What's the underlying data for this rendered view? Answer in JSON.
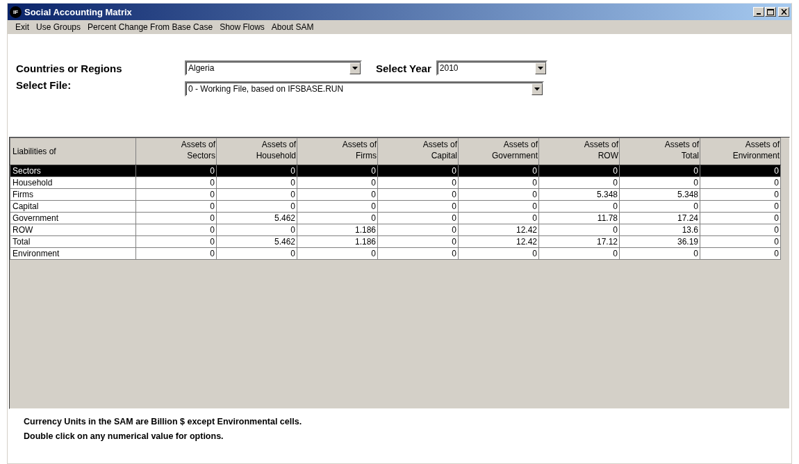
{
  "window": {
    "title": "Social Accounting Matrix",
    "app_icon_text": "IF"
  },
  "menu": [
    {
      "label": "Exit"
    },
    {
      "label": "Use Groups"
    },
    {
      "label": "Percent Change From Base Case"
    },
    {
      "label": "Show Flows"
    },
    {
      "label": "About SAM"
    }
  ],
  "selectors": {
    "region": {
      "label": "Countries or Regions",
      "value": "Algeria"
    },
    "year": {
      "label": "Select Year",
      "value": "2010"
    },
    "file": {
      "label": "Select File:",
      "value": "0 - Working File, based on IFSBASE.RUN"
    }
  },
  "table": {
    "corner": "Liabilities of",
    "columns": [
      "Assets of Sectors",
      "Assets of Household",
      "Assets of Firms",
      "Assets of Capital",
      "Assets of Government",
      "Assets of ROW",
      "Assets of Total",
      "Assets of Environment"
    ],
    "rows": [
      {
        "label": "Sectors",
        "selected": true,
        "cells": [
          "0",
          "0",
          "0",
          "0",
          "0",
          "0",
          "0",
          "0"
        ]
      },
      {
        "label": "Household",
        "selected": false,
        "cells": [
          "0",
          "0",
          "0",
          "0",
          "0",
          "0",
          "0",
          "0"
        ]
      },
      {
        "label": "Firms",
        "selected": false,
        "cells": [
          "0",
          "0",
          "0",
          "0",
          "0",
          "5.348",
          "5.348",
          "0"
        ]
      },
      {
        "label": "Capital",
        "selected": false,
        "cells": [
          "0",
          "0",
          "0",
          "0",
          "0",
          "0",
          "0",
          "0"
        ]
      },
      {
        "label": "Government",
        "selected": false,
        "cells": [
          "0",
          "5.462",
          "0",
          "0",
          "0",
          "11.78",
          "17.24",
          "0"
        ]
      },
      {
        "label": "ROW",
        "selected": false,
        "cells": [
          "0",
          "0",
          "1.186",
          "0",
          "12.42",
          "0",
          "13.6",
          "0"
        ]
      },
      {
        "label": "Total",
        "selected": false,
        "cells": [
          "0",
          "5.462",
          "1.186",
          "0",
          "12.42",
          "17.12",
          "36.19",
          "0"
        ]
      },
      {
        "label": "Environment",
        "selected": false,
        "cells": [
          "0",
          "0",
          "0",
          "0",
          "0",
          "0",
          "0",
          "0"
        ]
      }
    ]
  },
  "notes": [
    "Currency Units in the SAM are Billion $ except Environmental cells.",
    "Double click on any numerical value for options."
  ]
}
